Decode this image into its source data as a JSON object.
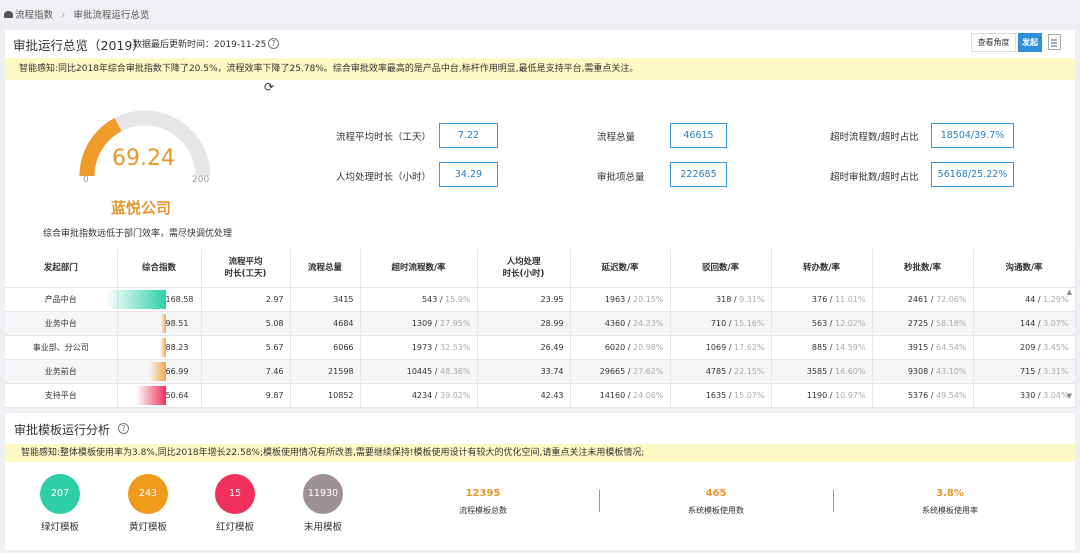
{
  "breadcrumb": {
    "root": "流程指数",
    "current": "审批流程运行总览"
  },
  "overview": {
    "title": "审批运行总览（2019）",
    "updated": "数据最后更新时间：2019-11-25",
    "help": "?",
    "view_role_label": "查看角度",
    "send_label": "发起",
    "notice": "智能感知:同比2018年综合审批指数下降了20.5%，流程效率下降了25.78%。综合审批效率最高的是产品中台,标杆作用明显,最低是支持平台,需重点关注。"
  },
  "gauge": {
    "value": "69.24",
    "fraction": 0.3462,
    "min": "0",
    "max": "200",
    "company": "蓝悦公司",
    "note": "综合审批指数远低于部门效率，需尽快调优处理",
    "fill_color": "#f09a2a",
    "track_color": "#e6e6e6"
  },
  "metrics": [
    {
      "label": "流程平均时长（工天）",
      "value": "7.22"
    },
    {
      "label": "人均处理时长（小时）",
      "value": "34.29"
    },
    {
      "label": "流程总量",
      "value": "46615"
    },
    {
      "label": "审批项总量",
      "value": "222685"
    },
    {
      "label": "超时流程数/超时占比",
      "value": "18504/39.7%"
    },
    {
      "label": "超时审批数/超时占比",
      "value": "56168/25.22%"
    }
  ],
  "table": {
    "headers": [
      "发起部门",
      "综合指数",
      "流程平均\n时长(工天)",
      "流程总量",
      "超时流程数/率",
      "人均处理\n时长(小时)",
      "延迟数/率",
      "驳回数/率",
      "转办数/率",
      "秒批数/率",
      "沟通数/率"
    ],
    "rows": [
      {
        "dept": "产品中台",
        "index": "168.58",
        "index_fraction": 0.84,
        "bar_color": "#2ecfa6",
        "avg": "2.97",
        "total": "3415",
        "overtime": "543",
        "overtime_pct": "15.9%",
        "person": "23.95",
        "delay": "1963",
        "delay_pct": "20.15%",
        "reject": "318",
        "reject_pct": "9.31%",
        "transfer": "376",
        "transfer_pct": "11.01%",
        "instant": "2461",
        "instant_pct": "72.06%",
        "comm": "44",
        "comm_pct": "1.29%"
      },
      {
        "dept": "业务中台",
        "index": "98.51",
        "index_fraction": 0.07,
        "bar_color": "#f3a54a",
        "avg": "5.08",
        "total": "4684",
        "overtime": "1309",
        "overtime_pct": "27.95%",
        "person": "28.99",
        "delay": "4360",
        "delay_pct": "24.23%",
        "reject": "710",
        "reject_pct": "15.16%",
        "transfer": "563",
        "transfer_pct": "12.02%",
        "instant": "2725",
        "instant_pct": "58.18%",
        "comm": "144",
        "comm_pct": "3.07%"
      },
      {
        "dept": "事业部、分公司",
        "index": "88.23",
        "index_fraction": 0.08,
        "bar_color": "#f3a54a",
        "avg": "5.67",
        "total": "6066",
        "overtime": "1973",
        "overtime_pct": "32.53%",
        "person": "26.49",
        "delay": "6020",
        "delay_pct": "20.98%",
        "reject": "1069",
        "reject_pct": "17.62%",
        "transfer": "885",
        "transfer_pct": "14.59%",
        "instant": "3915",
        "instant_pct": "64.54%",
        "comm": "209",
        "comm_pct": "3.45%"
      },
      {
        "dept": "业务前台",
        "index": "66.99",
        "index_fraction": 0.23,
        "bar_color": "#f3a54a",
        "avg": "7.46",
        "total": "21598",
        "overtime": "10445",
        "overtime_pct": "48.36%",
        "person": "33.74",
        "delay": "29665",
        "delay_pct": "27.62%",
        "reject": "4785",
        "reject_pct": "22.15%",
        "transfer": "3585",
        "transfer_pct": "16.60%",
        "instant": "9308",
        "instant_pct": "43.10%",
        "comm": "715",
        "comm_pct": "3.31%"
      },
      {
        "dept": "支持平台",
        "index": "50.64",
        "index_fraction": 0.42,
        "bar_color": "#f0305a",
        "avg": "9.87",
        "total": "10852",
        "overtime": "4234",
        "overtime_pct": "39.02%",
        "person": "42.43",
        "delay": "14160",
        "delay_pct": "24.06%",
        "reject": "1635",
        "reject_pct": "15.07%",
        "transfer": "1190",
        "transfer_pct": "10.97%",
        "instant": "5376",
        "instant_pct": "49.54%",
        "comm": "330",
        "comm_pct": "3.04%"
      }
    ]
  },
  "template": {
    "title": "审批模板运行分析",
    "help": "?",
    "notice": "智能感知:整体模板使用率为3.8%,同比2018年增长22.58%;模板使用情况有所改善,需要继续保持!模板使用设计有较大的优化空间,请重点关注未用模板情况;",
    "circles": [
      {
        "value": "207",
        "label": "绿灯模板",
        "color": "#2ecfa6"
      },
      {
        "value": "243",
        "label": "黄灯模板",
        "color": "#f09a1c"
      },
      {
        "value": "15",
        "label": "红灯模板",
        "color": "#f0305a"
      },
      {
        "value": "11930",
        "label": "未用模板",
        "color": "#9e9196"
      }
    ],
    "stats": [
      {
        "value": "12395",
        "label": "流程模板总数"
      },
      {
        "value": "465",
        "label": "系统模板使用数"
      },
      {
        "value": "3.8%",
        "label": "系统模板使用率"
      }
    ]
  }
}
